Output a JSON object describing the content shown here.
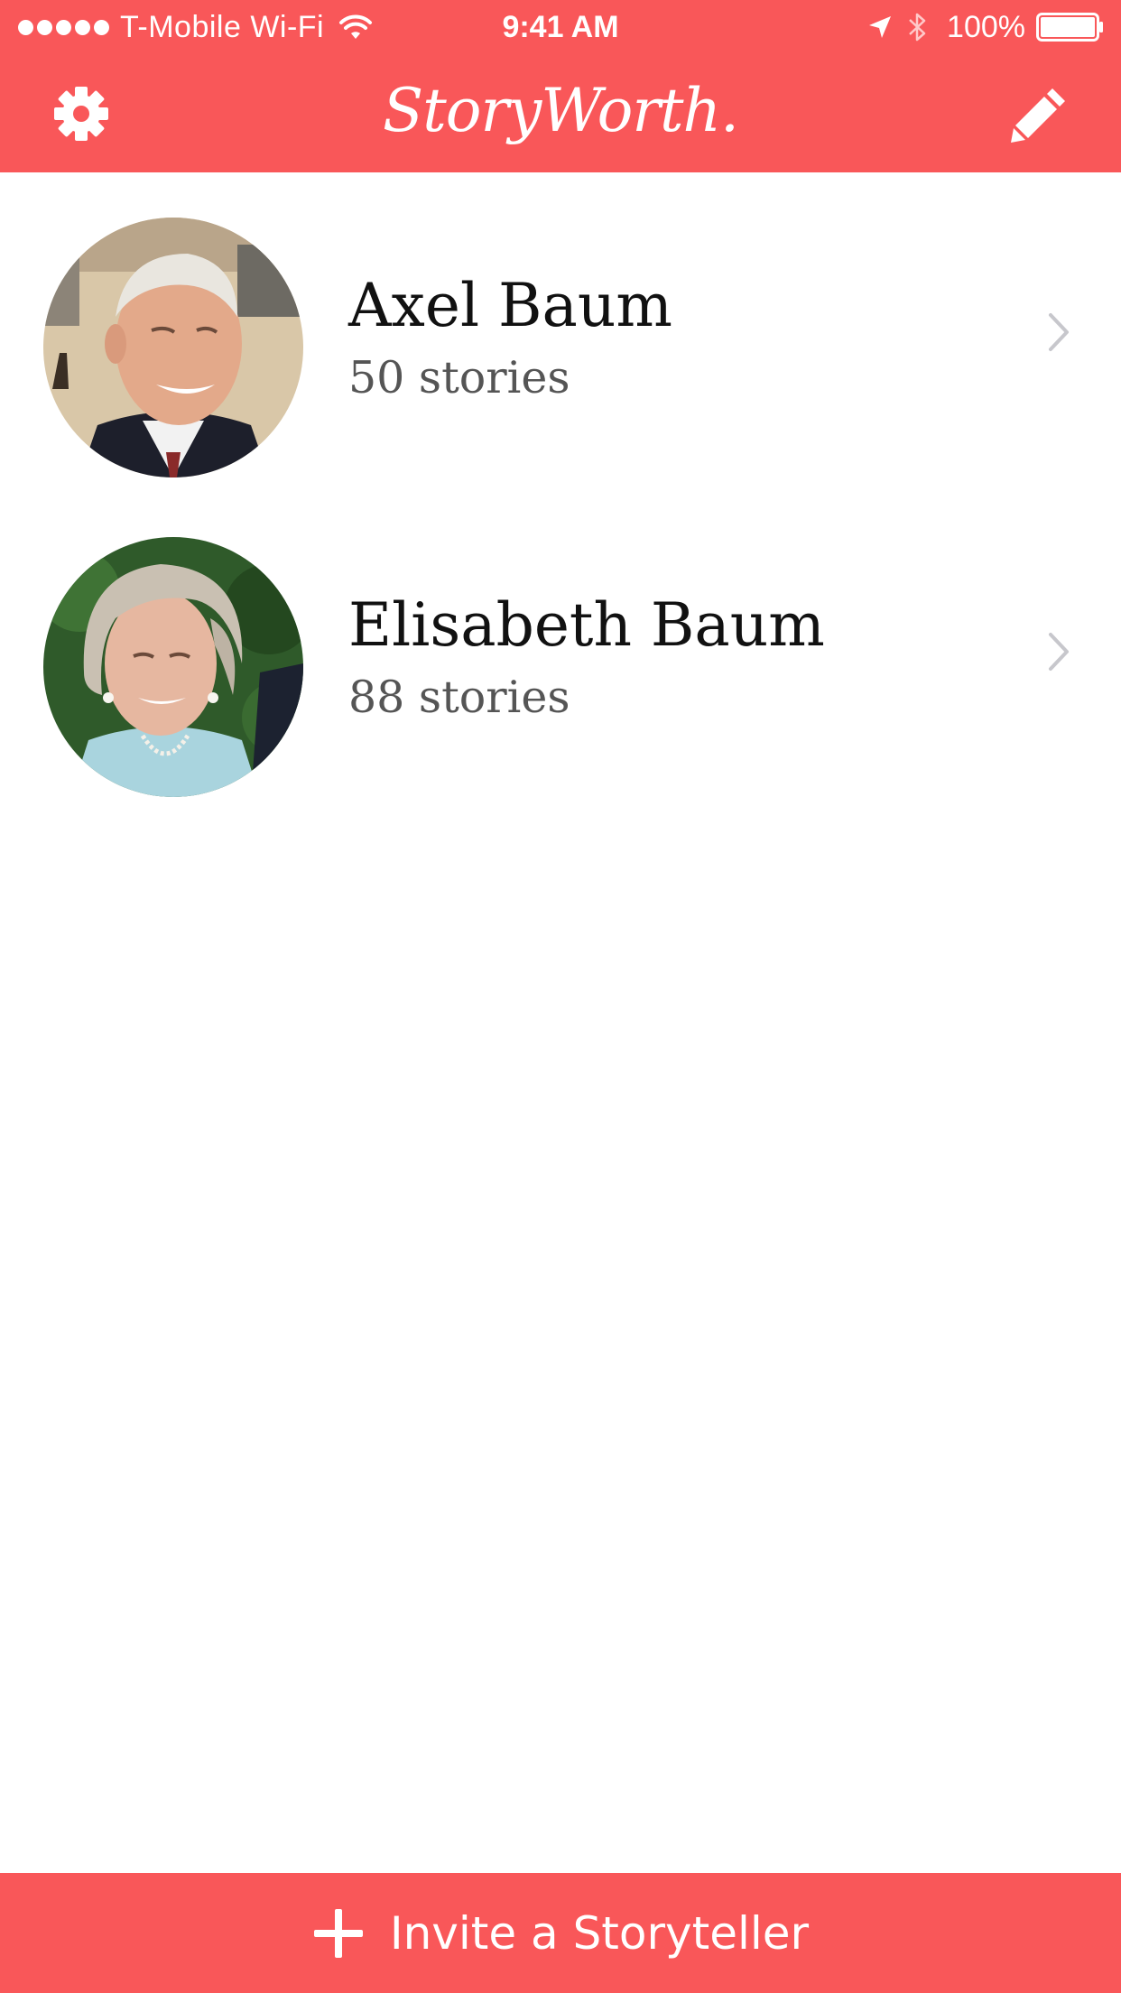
{
  "status_bar": {
    "carrier": "T-Mobile Wi-Fi",
    "time": "9:41 AM",
    "battery": "100%",
    "icons": [
      "signal-dots-icon",
      "wifi-icon",
      "location-icon",
      "bluetooth-icon",
      "battery-icon"
    ]
  },
  "nav": {
    "title": "StoryWorth.",
    "left_icon": "gear-icon",
    "right_icon": "pencil-icon"
  },
  "storytellers": [
    {
      "name": "Axel Baum",
      "count": "50 stories"
    },
    {
      "name": "Elisabeth Baum",
      "count": "88 stories"
    }
  ],
  "bottom": {
    "invite_label": "Invite a Storyteller",
    "icon": "plus-icon"
  },
  "colors": {
    "accent": "#f95759",
    "name_text": "#111111",
    "count_text": "#555555",
    "chevron": "#c7c7cc"
  }
}
